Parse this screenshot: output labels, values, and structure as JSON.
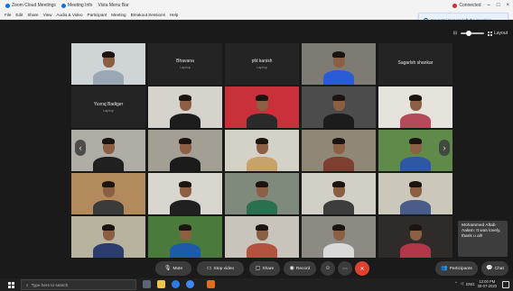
{
  "titlebar": {
    "app_title": "Zoom Cloud Meetings",
    "tab_meeting": "Meeting Info",
    "tab_share": "Vista Menu Bar",
    "connected": "Connected",
    "minimize": "–",
    "maximize": "□",
    "close": "×"
  },
  "menubar": [
    "File",
    "Edit",
    "Share",
    "View",
    "Audio & Video",
    "Participant",
    "Meeting",
    "Breakout Sessions",
    "Help"
  ],
  "notification": {
    "text": "Sayantni Kapoor left the meeting"
  },
  "view": {
    "zoom_label": "⊟",
    "layout_label": "Layout"
  },
  "tiles": [
    {
      "type": "video",
      "bg": "#cfd4d6",
      "body": "#9aa7b4"
    },
    {
      "type": "name",
      "name": "Bhavana",
      "sub": "Laptop"
    },
    {
      "type": "name",
      "name": "pfd kanish",
      "sub": "Laptop"
    },
    {
      "type": "video",
      "bg": "#7d7b73",
      "body": "#2a5bd7"
    },
    {
      "type": "name",
      "name": "Sagarlsh shankar",
      "sub": ""
    },
    {
      "type": "name",
      "name": "Yuvraj Badiger",
      "sub": "Laptop"
    },
    {
      "type": "video",
      "bg": "#d6d3cc",
      "body": "#1d1d1d"
    },
    {
      "type": "video",
      "bg": "#c8313a",
      "body": "#2a2a2a"
    },
    {
      "type": "video",
      "bg": "#4c4c4c",
      "body": "#1c1c1c"
    },
    {
      "type": "video",
      "bg": "#e6e3dd",
      "body": "#b44a5a"
    },
    {
      "type": "video",
      "bg": "#b0ada6",
      "body": "#202020"
    },
    {
      "type": "video",
      "bg": "#a49f94",
      "body": "#1b1b1b"
    },
    {
      "type": "video",
      "bg": "#d4d1c7",
      "body": "#c7a36b"
    },
    {
      "type": "video",
      "bg": "#8f8876",
      "body": "#7d3f2f"
    },
    {
      "type": "video",
      "bg": "#5f8a4a",
      "body": "#2f58a4"
    },
    {
      "type": "video",
      "bg": "#b28a5c",
      "body": "#3b3b3b"
    },
    {
      "type": "video",
      "bg": "#d9d6cf",
      "body": "#202020"
    },
    {
      "type": "video",
      "bg": "#7f8a7d",
      "body": "#2a6f4e"
    },
    {
      "type": "video",
      "bg": "#d2cfc6",
      "body": "#3d3d3d"
    },
    {
      "type": "video",
      "bg": "#ccc7bb",
      "body": "#4a5d8a"
    },
    {
      "type": "video",
      "bg": "#b7b39f",
      "body": "#2b3c6e"
    },
    {
      "type": "video",
      "bg": "#4b7a3d",
      "body": "#1e5aa8"
    },
    {
      "type": "video",
      "bg": "#c8c4bc",
      "body": "#b3523e"
    },
    {
      "type": "video",
      "bg": "#8c8a83",
      "body": "#d9d9d9"
    },
    {
      "type": "video",
      "bg": "#2e2b28",
      "body": "#b33649"
    }
  ],
  "nav": {
    "left": "‹",
    "right": "›"
  },
  "chat_preview": {
    "text": "Mohammed Aftab Aalam: It was lovely, thank u all!"
  },
  "toolbar": {
    "mute": "Mute",
    "stop_video": "Stop video",
    "share": "Share",
    "record": "Record",
    "participants": "Participants",
    "chat": "Chat"
  },
  "taskbar": {
    "search_placeholder": "Type here to search",
    "time": "12:00 PM",
    "date": "30-07-2020",
    "lang": "ENG"
  }
}
